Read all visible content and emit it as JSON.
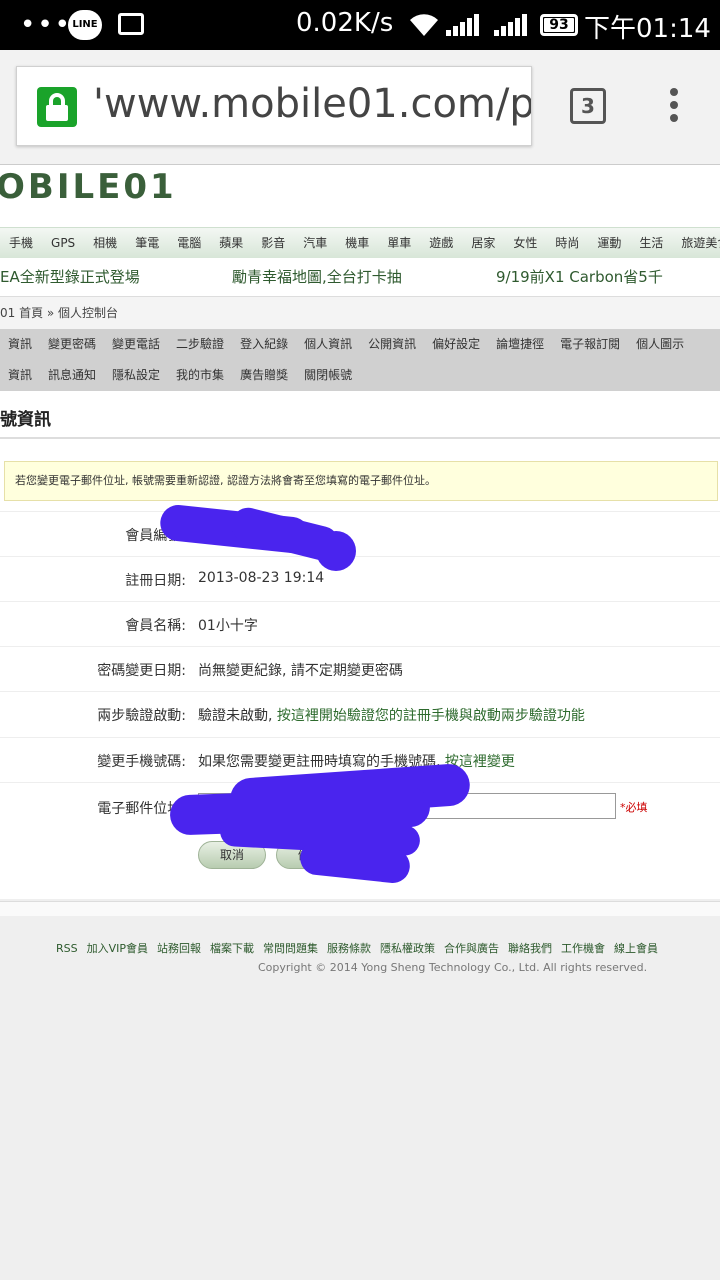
{
  "status_bar": {
    "net_speed": "0.02K/s",
    "battery": "93",
    "time": "下午01:14",
    "line_label": "LINE"
  },
  "browser": {
    "url": "'www.mobile01.com/p",
    "tab_count": "3"
  },
  "site": {
    "logo": "OBILE01",
    "categories": [
      "手機",
      "GPS",
      "相機",
      "筆電",
      "電腦",
      "蘋果",
      "影音",
      "汽車",
      "機車",
      "單車",
      "遊戲",
      "居家",
      "女性",
      "時尚",
      "運動",
      "生活",
      "旅遊美食"
    ],
    "promos": [
      "EA全新型錄正式登場",
      "勵青幸福地圖,全台打卡抽",
      "9/19前X1 Carbon省5千"
    ],
    "breadcrumb": "01 首頁 » 個人控制台",
    "subnav_row1": [
      "資訊",
      "變更密碼",
      "變更電話",
      "二步驗證",
      "登入紀錄",
      "個人資訊",
      "公開資訊",
      "偏好設定",
      "論壇捷徑",
      "電子報訂閱",
      "個人圖示"
    ],
    "subnav_row2": [
      "資訊",
      "訊息通知",
      "隱私設定",
      "我的市集",
      "廣告贈獎",
      "關閉帳號"
    ]
  },
  "account": {
    "title": "號資訊",
    "notice": "若您變更電子郵件位址, 帳號需要重新認證, 認證方法將會寄至您填寫的電子郵件位址。",
    "fields": {
      "member_id_label": "會員編號:",
      "reg_date_label": "註冊日期:",
      "reg_date": "2013-08-23 19:14",
      "member_name_label": "會員名稱:",
      "member_name": "01小十字",
      "pwd_change_label": "密碼變更日期:",
      "pwd_change": "尚無變更紀錄, 請不定期變更密碼",
      "two_step_label": "兩步驗證啟動:",
      "two_step_value": "驗證未啟動,",
      "two_step_link": "按這裡開始驗證您的註冊手機與啟動兩步驗證功能",
      "phone_label": "變更手機號碼:",
      "phone_value": "如果您需要變更註冊時填寫的手機號碼,",
      "phone_link": "按這裡變更",
      "email_label": "電子郵件位址:",
      "required": "*必填"
    },
    "buttons": {
      "cancel": "取消",
      "save": "儲存"
    }
  },
  "footer": {
    "links": [
      "RSS",
      "加入VIP會員",
      "站務回報",
      "檔案下載",
      "常問問題集",
      "服務條款",
      "隱私權政策",
      "合作與廣告",
      "聯絡我們",
      "工作機會",
      "線上會員"
    ],
    "copyright": "Copyright © 2014 Yong Sheng Technology Co., Ltd. All rights reserved."
  },
  "colors": {
    "link_green": "#2d6a2d",
    "scribble": "#4a24ee",
    "lock_green": "#1aa32a"
  }
}
